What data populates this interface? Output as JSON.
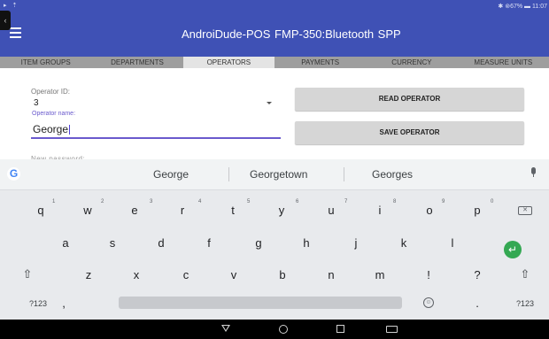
{
  "status_bar": {
    "left_icons": "▸ ⇡",
    "right_text": "✱ ⊚67% ▬ 11:07"
  },
  "app_bar": {
    "title": "AndroiDude-POS   FMP-350:Bluetooth SPP",
    "menu_icon": "hamburger-icon"
  },
  "tabs": [
    {
      "label": "ITEM GROUPS",
      "active": false
    },
    {
      "label": "DEPARTMENTS",
      "active": false
    },
    {
      "label": "OPERATORS",
      "active": true
    },
    {
      "label": "PAYMENTS",
      "active": false
    },
    {
      "label": "CURRENCY",
      "active": false
    },
    {
      "label": "MEASURE UNITS",
      "active": false
    }
  ],
  "form": {
    "operator_id_label": "Operator ID:",
    "operator_id_value": "3",
    "operator_name_label": "Operator name:",
    "operator_name_value": "George",
    "next_field_peek": "New password:",
    "read_button": "READ OPERATOR",
    "save_button": "SAVE OPERATOR"
  },
  "keyboard": {
    "suggestions": [
      "George",
      "Georgetown",
      "Georges"
    ],
    "row1": [
      {
        "key": "q",
        "hint": "1"
      },
      {
        "key": "w",
        "hint": "2"
      },
      {
        "key": "e",
        "hint": "3"
      },
      {
        "key": "r",
        "hint": "4"
      },
      {
        "key": "t",
        "hint": "5"
      },
      {
        "key": "y",
        "hint": "6"
      },
      {
        "key": "u",
        "hint": "7"
      },
      {
        "key": "i",
        "hint": "8"
      },
      {
        "key": "o",
        "hint": "9"
      },
      {
        "key": "p",
        "hint": "0"
      }
    ],
    "row2": [
      "a",
      "s",
      "d",
      "f",
      "g",
      "h",
      "j",
      "k",
      "l"
    ],
    "row3": [
      "z",
      "x",
      "c",
      "v",
      "b",
      "n",
      "m",
      "!",
      "?"
    ],
    "symbols_key": "?123",
    "comma_key": ",",
    "period_key": ".",
    "shift_glyph": "⇧",
    "enter_glyph": "↵",
    "backspace_glyph": "✕",
    "emoji_glyph": "☺"
  },
  "colors": {
    "primary": "#3f51b5",
    "accent": "#6a5acd",
    "enter_key": "#34a853"
  }
}
